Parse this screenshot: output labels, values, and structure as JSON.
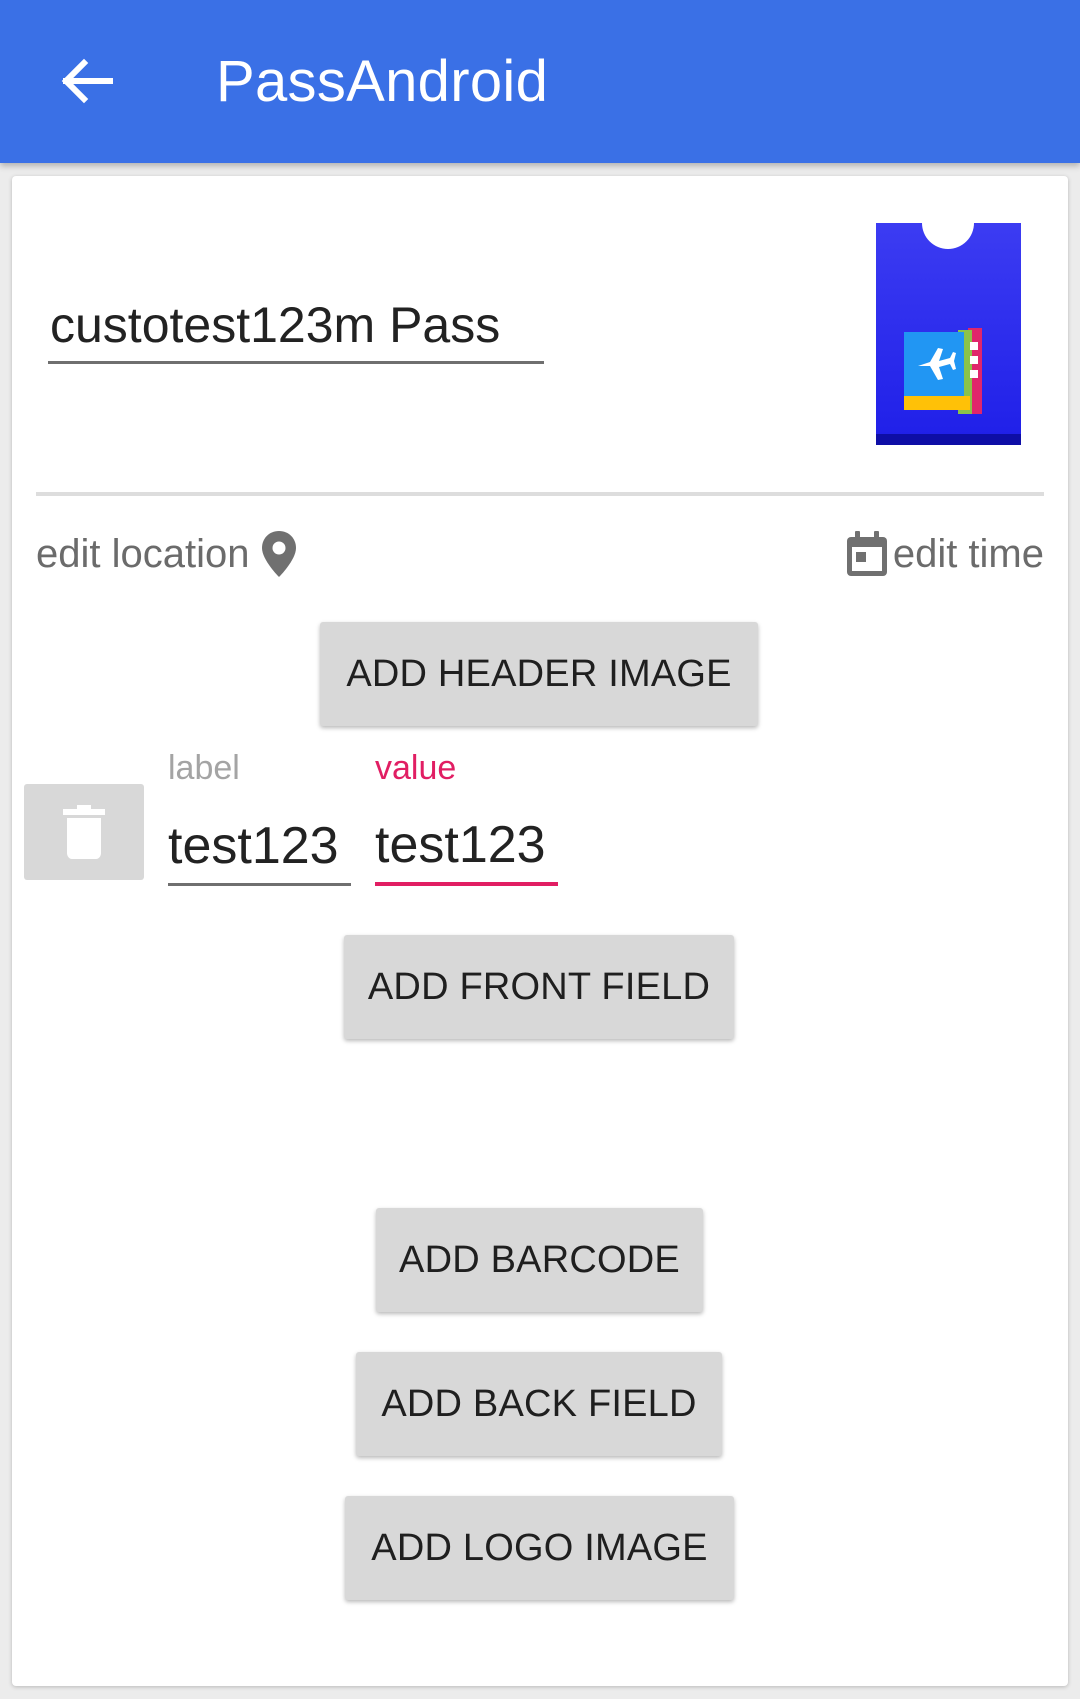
{
  "app_bar": {
    "title": "PassAndroid",
    "back_icon": "arrow-left-icon",
    "background_color": "#3a70e6"
  },
  "pass": {
    "name_value": "custotest123m Pass",
    "thumbnail_icon": "boarding-pass-airplane-icon"
  },
  "actions": {
    "edit_location_label": "edit location",
    "location_icon": "map-pin-icon",
    "edit_time_label": "edit time",
    "time_icon": "calendar-icon"
  },
  "buttons": {
    "add_header_image": "ADD HEADER IMAGE",
    "add_front_field": "ADD FRONT FIELD",
    "add_barcode": "ADD BARCODE",
    "add_back_field": "ADD BACK FIELD",
    "add_logo_image": "ADD LOGO IMAGE"
  },
  "front_field": {
    "label_caption": "label",
    "label_value": "test123",
    "value_caption": "value",
    "value_value": "test123",
    "delete_icon": "trash-icon",
    "focus_color": "#e11e63"
  }
}
